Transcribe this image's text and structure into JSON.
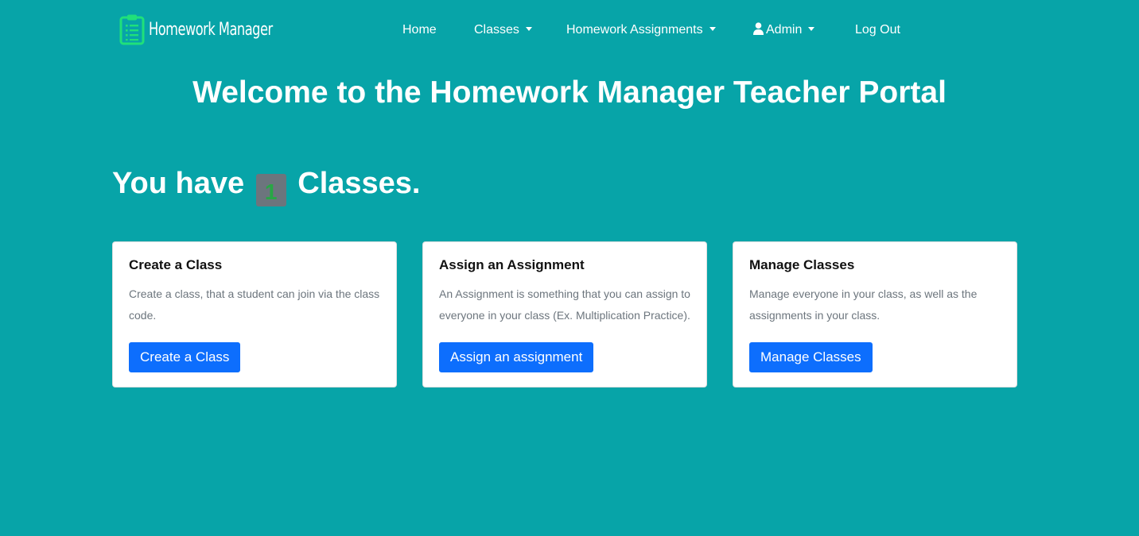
{
  "navbar": {
    "brand": "Homework Manager",
    "brand_icon": "clipboard-list-icon",
    "items": {
      "home": "Home",
      "classes": "Classes",
      "homework_assignments": "Homework Assignments",
      "admin": "Admin",
      "logout": "Log Out"
    },
    "colors": {
      "background": "#07a4a8",
      "brand_icon": "#20e07a",
      "text": "#ffffff"
    }
  },
  "main": {
    "title": "Welcome to the Homework Manager Teacher Portal",
    "class_count": {
      "prefix": "You have",
      "count": "1",
      "suffix": "Classes."
    },
    "cards": [
      {
        "title": "Create a Class",
        "text": "Create a class, that a student can join via the class code.",
        "button": "Create a Class"
      },
      {
        "title": "Assign an Assignment",
        "text": "An Assignment is something that you can assign to everyone in your class (Ex. Multiplication Practice).",
        "button": "Assign an assignment"
      },
      {
        "title": "Manage Classes",
        "text": "Manage everyone in your class, as well as the assignments in your class.",
        "button": "Manage Classes"
      }
    ],
    "colors": {
      "button": "#0d6efd",
      "badge_bg": "#6c757d",
      "badge_text": "#28a745"
    }
  }
}
